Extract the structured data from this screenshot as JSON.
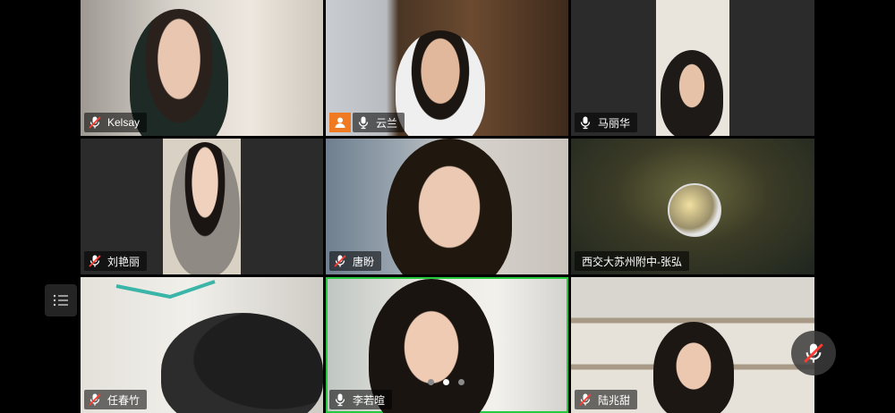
{
  "participants": [
    {
      "name": "Kelsay",
      "mic": "muted"
    },
    {
      "name": "云兰",
      "mic": "on",
      "host": true
    },
    {
      "name": "马丽华",
      "mic": "on"
    },
    {
      "name": "刘艳丽",
      "mic": "muted"
    },
    {
      "name": "唐盼",
      "mic": "muted"
    },
    {
      "name": "西交大苏州附中-张弘",
      "mic": "none",
      "avatar": true
    },
    {
      "name": "任春竹",
      "mic": "muted"
    },
    {
      "name": "李若暄",
      "mic": "on",
      "active_speaker": true
    },
    {
      "name": "陆兆甜",
      "mic": "muted"
    }
  ],
  "pagination": {
    "pages": 3,
    "current": 2
  },
  "colors": {
    "active_border": "#27c93f",
    "host_badge": "#f07a22",
    "muted_mic": "#ff3b30"
  },
  "icons": {
    "side": "participant-list-icon",
    "floating": "microphone-muted-icon"
  }
}
